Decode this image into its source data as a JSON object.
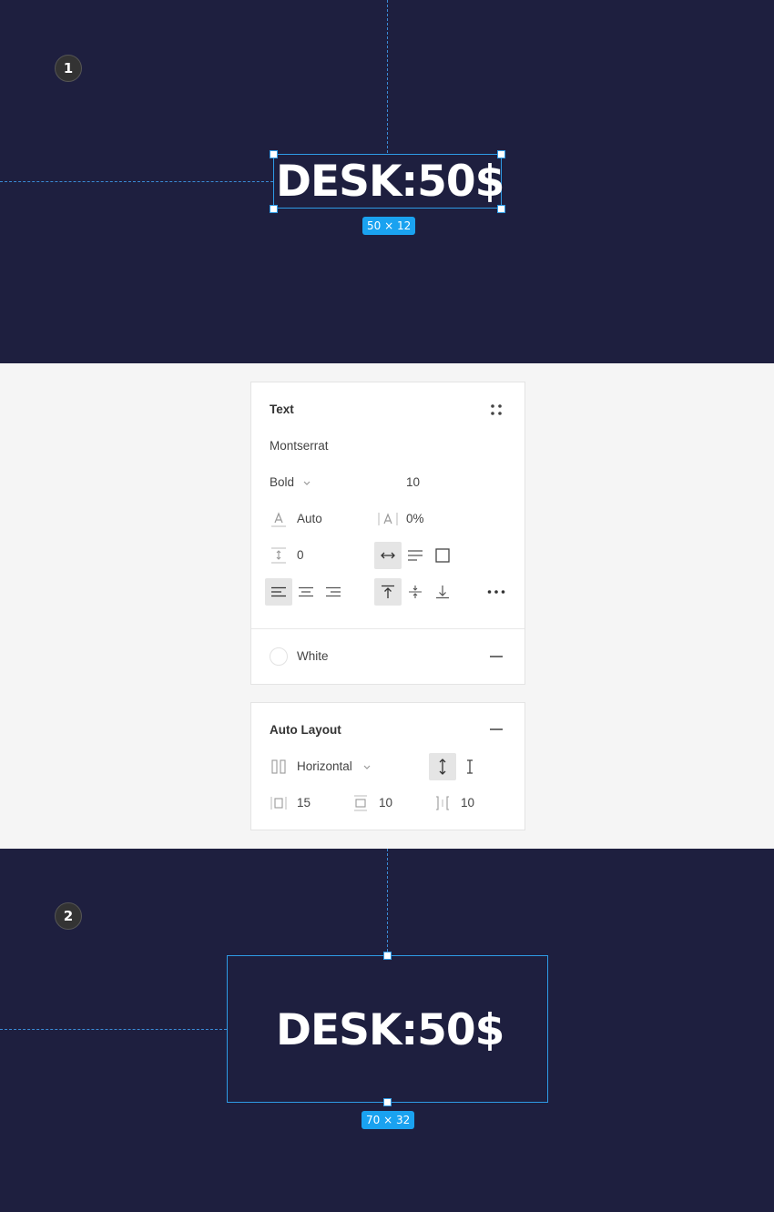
{
  "step1": {
    "badge": "1",
    "text": "DESK:50$",
    "dimensions": "50 × 12"
  },
  "step2": {
    "badge": "2",
    "text": "DESK:50$",
    "dimensions": "70 × 32"
  },
  "text_panel": {
    "title": "Text",
    "font_family": "Montserrat",
    "font_weight": "Bold",
    "font_size": "10",
    "line_height": "Auto",
    "letter_spacing": "0%",
    "paragraph_spacing": "0",
    "fill_name": "White",
    "fill_color": "#ffffff"
  },
  "auto_layout_panel": {
    "title": "Auto Layout",
    "direction": "Horizontal",
    "horizontal_padding": "15",
    "vertical_padding": "10",
    "item_spacing": "10"
  },
  "colors": {
    "canvas_bg": "#1e1f3f",
    "selection": "#2e9be6",
    "badge_bg": "#1aa2f0"
  }
}
